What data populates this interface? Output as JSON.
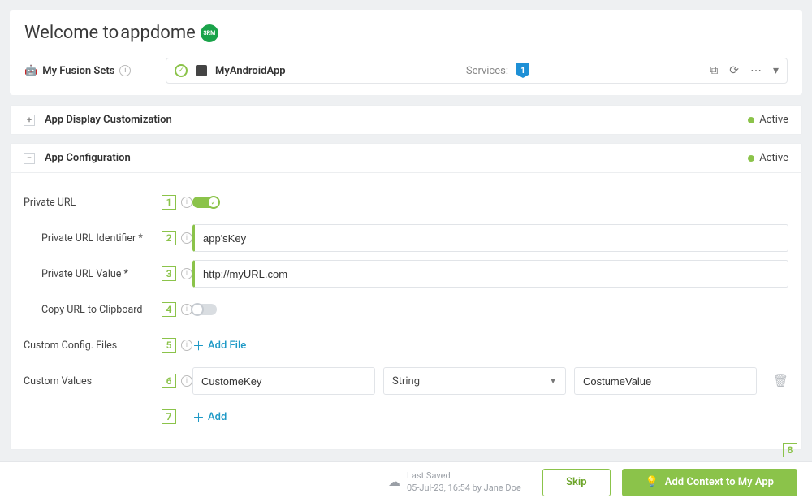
{
  "header": {
    "welcome_prefix": "Welcome to ",
    "brand": "appdome",
    "logo_text": "SRM",
    "fusion_sets_label": "My Fusion Sets",
    "app_name": "MyAndroidApp",
    "services_label": "Services:",
    "services_count": "1"
  },
  "sections": {
    "display_customization": {
      "title": "App Display Customization",
      "status": "Active"
    },
    "app_configuration": {
      "title": "App Configuration",
      "status": "Active"
    }
  },
  "form": {
    "private_url": {
      "label": "Private URL",
      "annot": "1"
    },
    "private_url_identifier": {
      "label": "Private URL Identifier *",
      "annot": "2",
      "value": "app'sKey"
    },
    "private_url_value": {
      "label": "Private URL Value *",
      "annot": "3",
      "value": "http://myURL.com"
    },
    "copy_url": {
      "label": "Copy URL to Clipboard",
      "annot": "4"
    },
    "custom_config_files": {
      "label": "Custom Config. Files",
      "annot": "5",
      "action": "Add File"
    },
    "custom_values": {
      "label": "Custom Values",
      "annot": "6",
      "key_value": "CustomeKey",
      "type_value": "String",
      "value_value": "CostumeValue",
      "add_annot": "7",
      "add_action": "Add"
    }
  },
  "footer": {
    "last_saved_title": "Last Saved",
    "last_saved_detail": "05-Jul-23, 16:54 by Jane Doe",
    "skip_label": "Skip",
    "primary_label": "Add Context to My App",
    "primary_annot": "8"
  }
}
